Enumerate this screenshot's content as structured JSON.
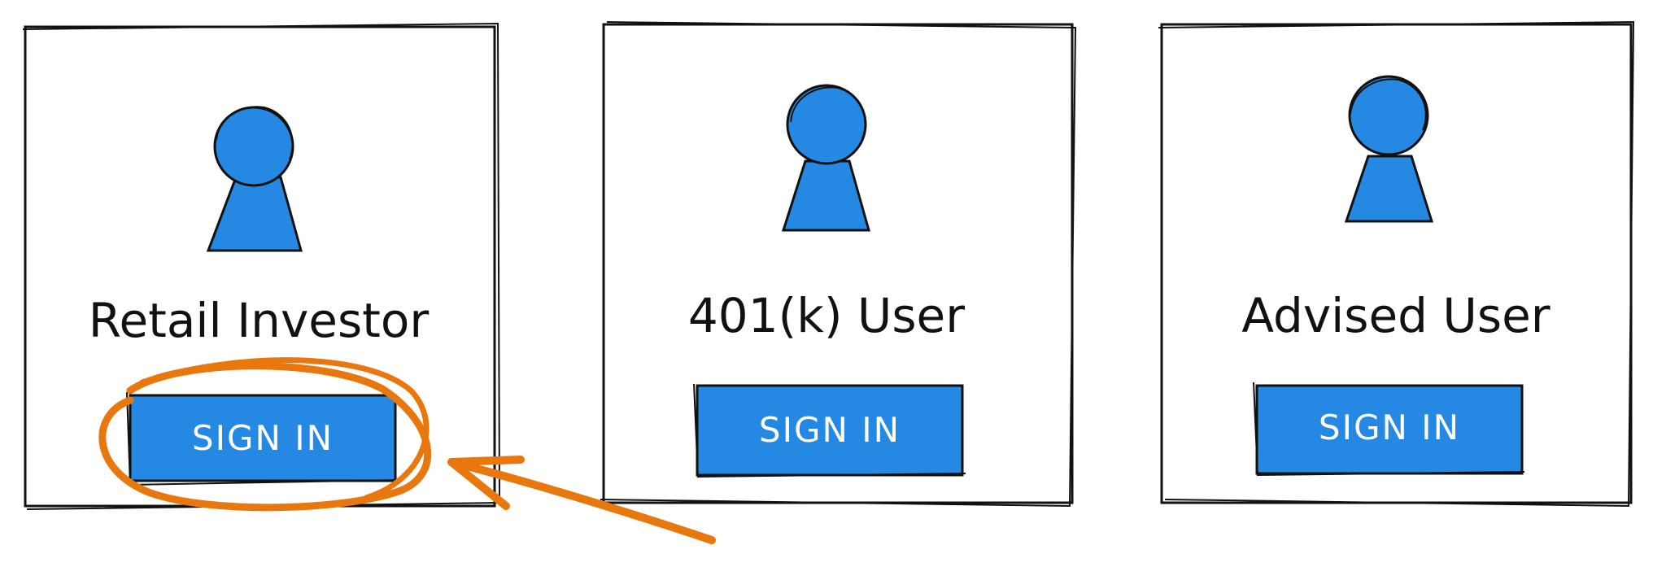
{
  "colors": {
    "accent": "#2589e3",
    "ink": "#111111",
    "highlight": "#e8780e",
    "background": "#ffffff"
  },
  "cards": [
    {
      "title": "Retail Investor",
      "button_label": "SIGN IN",
      "icon": "user-icon",
      "highlighted": true
    },
    {
      "title": "401(k) User",
      "button_label": "SIGN IN",
      "icon": "user-icon",
      "highlighted": false
    },
    {
      "title": "Advised User",
      "button_label": "SIGN IN",
      "icon": "user-icon",
      "highlighted": false
    }
  ],
  "annotation": {
    "shape": "circle-and-arrow",
    "target": "Retail Investor SIGN IN button"
  }
}
